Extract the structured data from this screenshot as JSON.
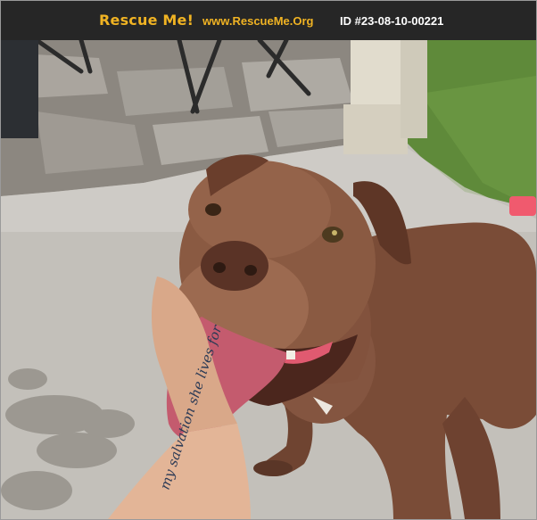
{
  "header": {
    "brand": "Rescue Me!",
    "site": "www.RescueMe.Org",
    "pet_id": "ID #23-08-10-00221"
  },
  "photo": {
    "subject": "dog-photo",
    "tattoo_text": "my salvation she lives for"
  },
  "colors": {
    "header_bg": "#262626",
    "brand": "#f0b323",
    "id_text": "#ffffff"
  }
}
